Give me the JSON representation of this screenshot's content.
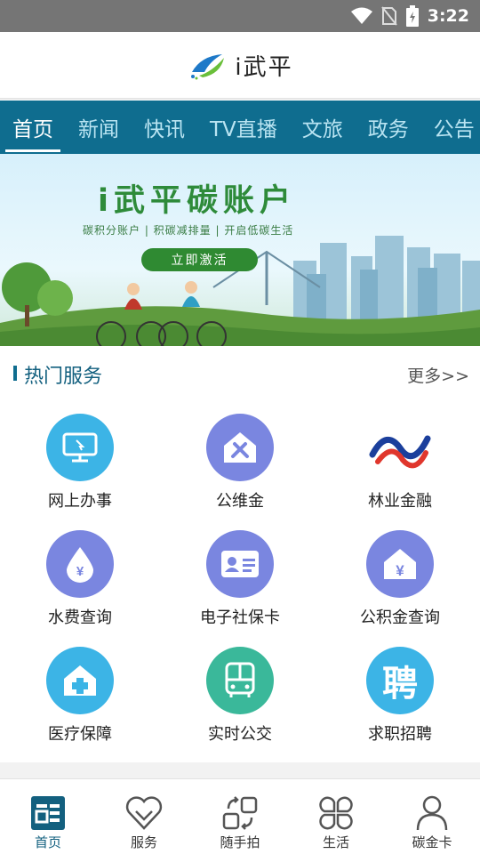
{
  "status_bar": {
    "time": "3:22",
    "icons": [
      "wifi-icon",
      "no-sim-icon",
      "battery-icon"
    ]
  },
  "header": {
    "title": "i武平",
    "logo": "wuping-logo-icon"
  },
  "nav_tabs": [
    {
      "label": "首页",
      "active": true
    },
    {
      "label": "新闻"
    },
    {
      "label": "快讯"
    },
    {
      "label": "TV直播"
    },
    {
      "label": "文旅"
    },
    {
      "label": "政务"
    },
    {
      "label": "公告"
    }
  ],
  "banner": {
    "title": "i武平碳账户",
    "subtitle": "碳积分账户 | 积碳减排量 | 开启低碳生活",
    "button": "立即激活"
  },
  "section": {
    "title": "热门服务",
    "more": "更多>>"
  },
  "services": [
    {
      "label": "网上办事",
      "icon": "monitor-icon",
      "color": "#3cb4e6"
    },
    {
      "label": "公维金",
      "icon": "house-tools-icon",
      "color": "#7a86e0"
    },
    {
      "label": "林业金融",
      "icon": "forestry-logo-icon",
      "color": "#ffffff"
    },
    {
      "label": "水费查询",
      "icon": "water-drop-yen-icon",
      "color": "#7a86e0"
    },
    {
      "label": "电子社保卡",
      "icon": "id-card-icon",
      "color": "#7a86e0"
    },
    {
      "label": "公积金查询",
      "icon": "house-yen-icon",
      "color": "#7a86e0"
    },
    {
      "label": "医疗保障",
      "icon": "medical-house-icon",
      "color": "#3cb4e6"
    },
    {
      "label": "实时公交",
      "icon": "bus-icon",
      "color": "#3ab89a"
    },
    {
      "label": "求职招聘",
      "icon": "recruit-icon",
      "color": "#3cb4e6",
      "glyph": "聘"
    }
  ],
  "bottom_nav": [
    {
      "label": "首页",
      "icon": "home-icon",
      "active": true
    },
    {
      "label": "服务",
      "icon": "heart-icon"
    },
    {
      "label": "随手拍",
      "icon": "snapshot-icon"
    },
    {
      "label": "生活",
      "icon": "clover-icon"
    },
    {
      "label": "碳金卡",
      "icon": "user-icon"
    }
  ]
}
